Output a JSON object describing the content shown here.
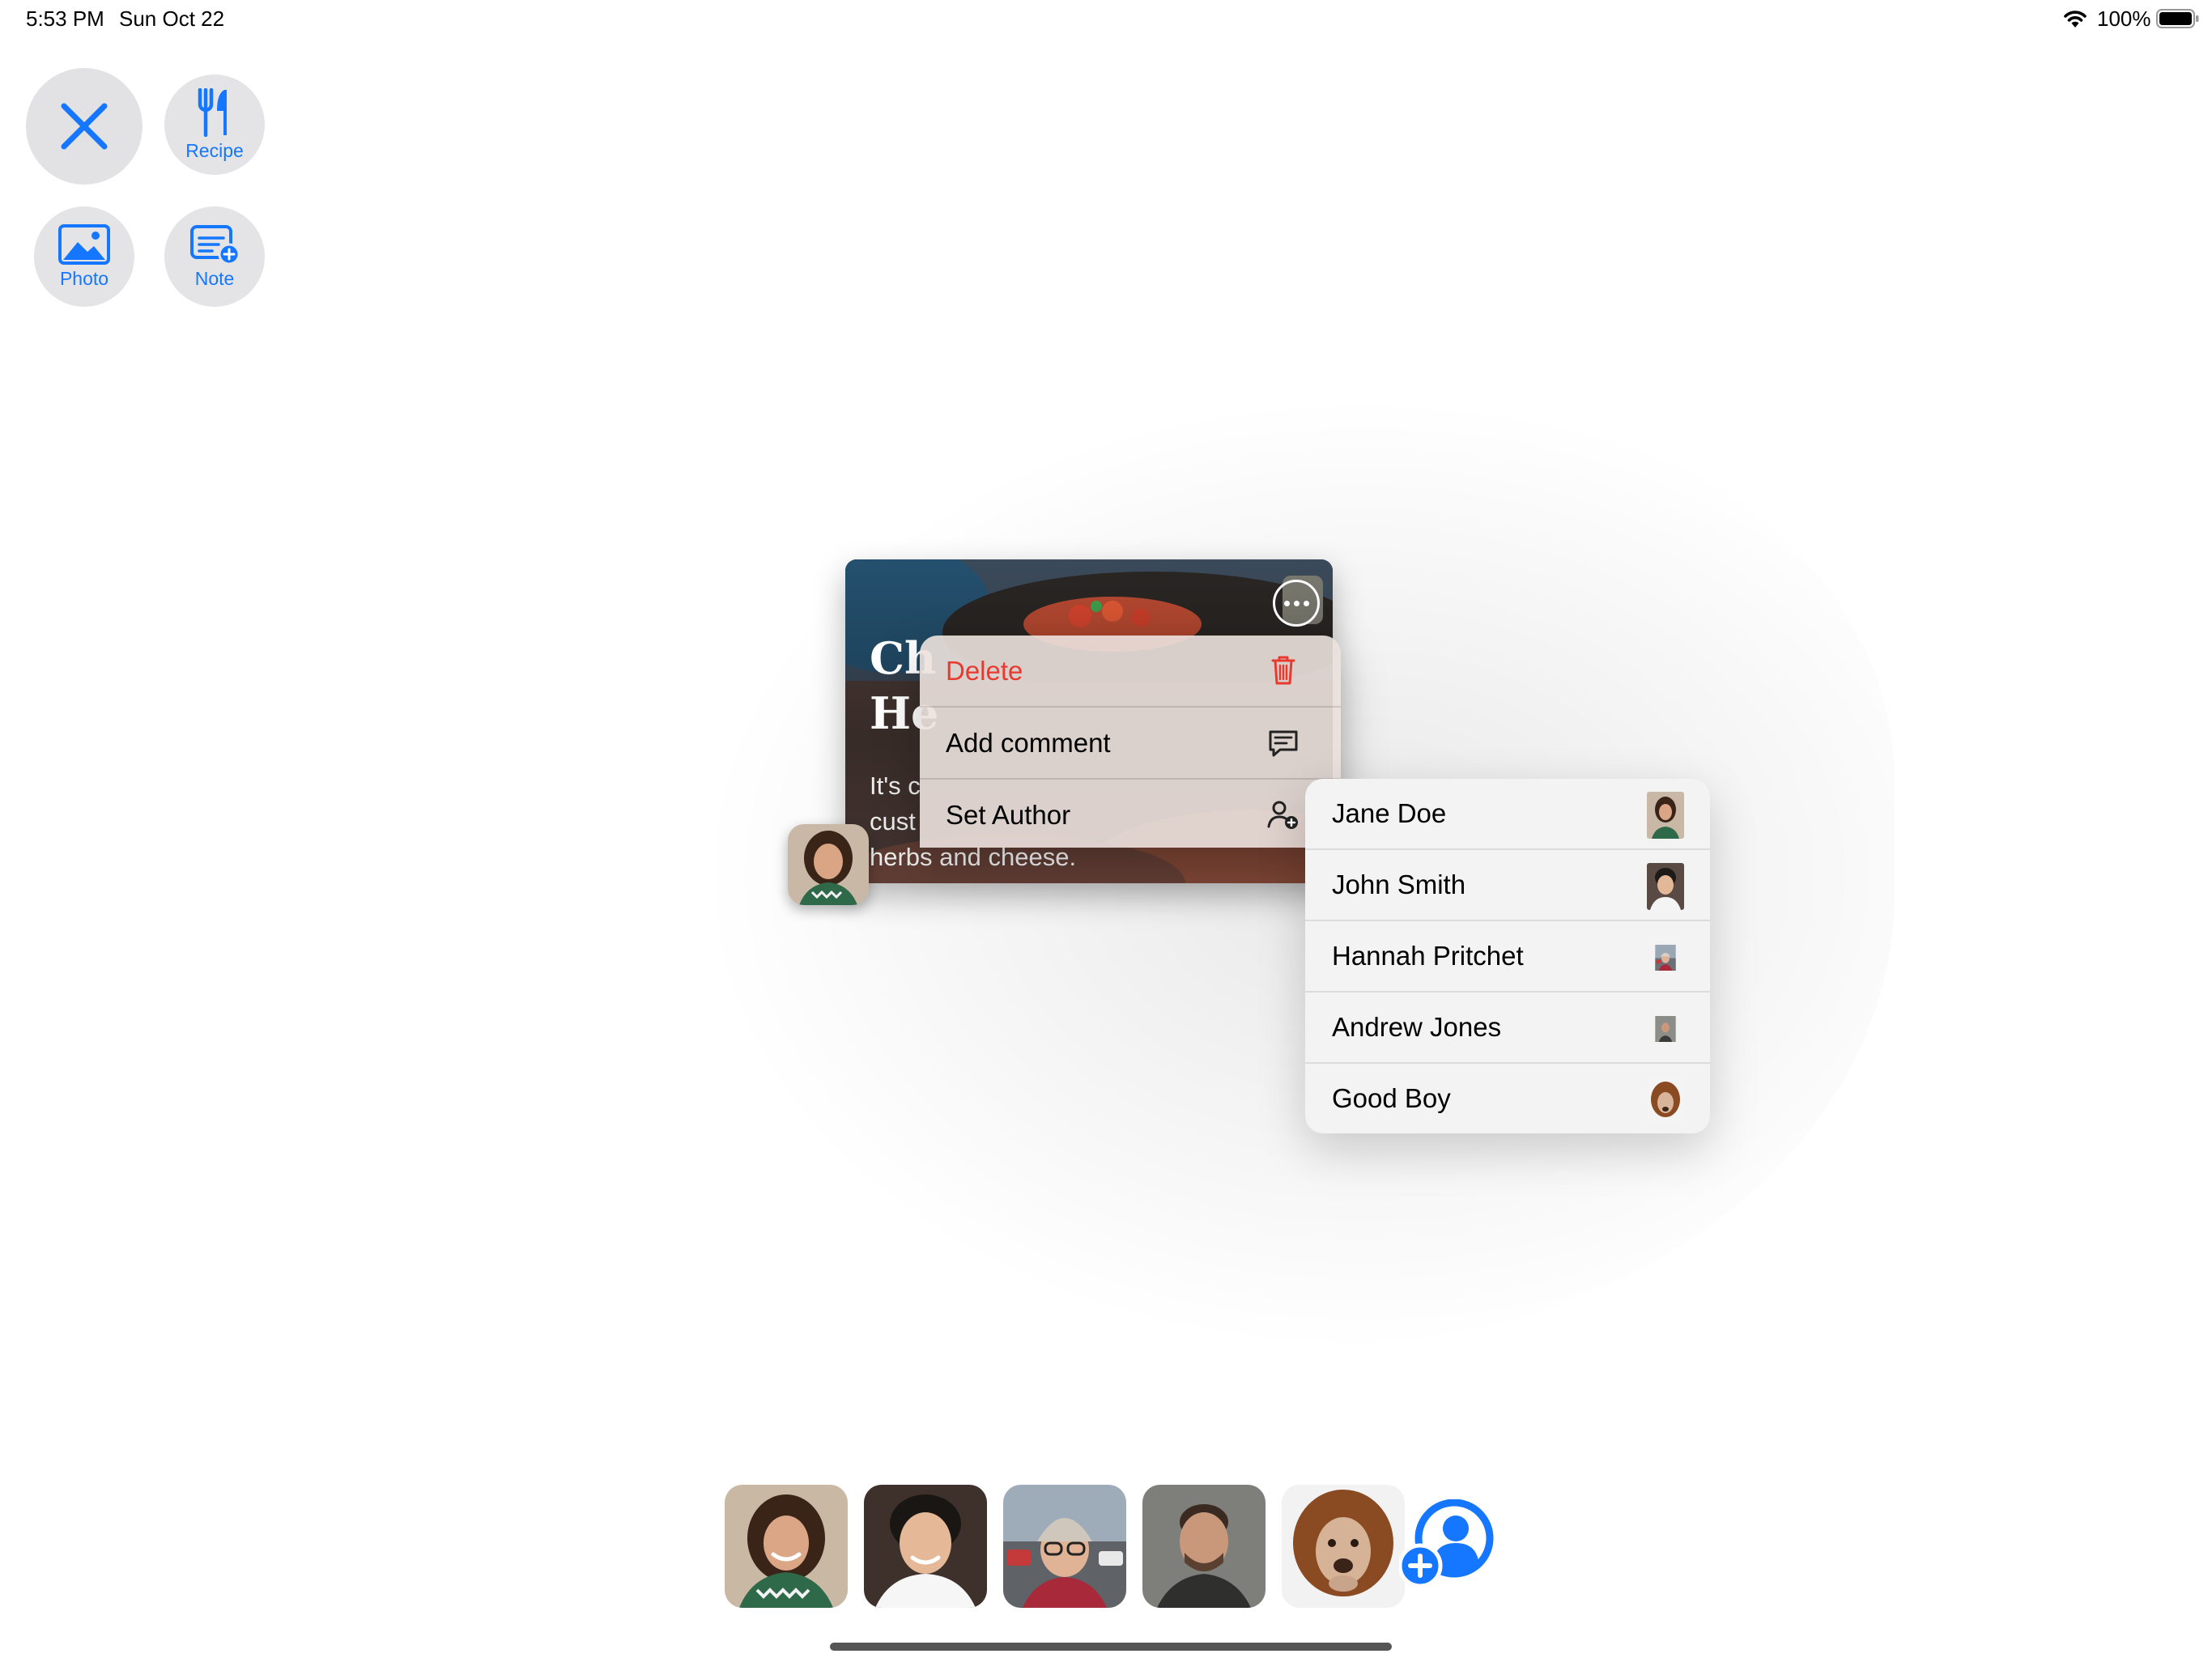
{
  "status_bar": {
    "time": "5:53 PM",
    "date": "Sun Oct 22",
    "battery": "100%"
  },
  "toolbar": {
    "recipe_label": "Recipe",
    "photo_label": "Photo",
    "note_label": "Note"
  },
  "card": {
    "title_line1": "Ch",
    "title_line2": "He",
    "body_line1": "It's c",
    "body_line2": "cust",
    "body_line3": "herbs and cheese."
  },
  "context_menu": {
    "items": [
      {
        "label": "Delete",
        "icon": "trash-icon"
      },
      {
        "label": "Add comment",
        "icon": "comment-icon"
      },
      {
        "label": "Set Author",
        "icon": "person-add-icon"
      }
    ]
  },
  "author_submenu": {
    "items": [
      {
        "label": "Jane Doe"
      },
      {
        "label": "John Smith"
      },
      {
        "label": "Hannah Pritchet"
      },
      {
        "label": "Andrew Jones"
      },
      {
        "label": "Good Boy"
      }
    ]
  },
  "colors": {
    "accent": "#1577ff",
    "destructive": "#e83a2f"
  }
}
